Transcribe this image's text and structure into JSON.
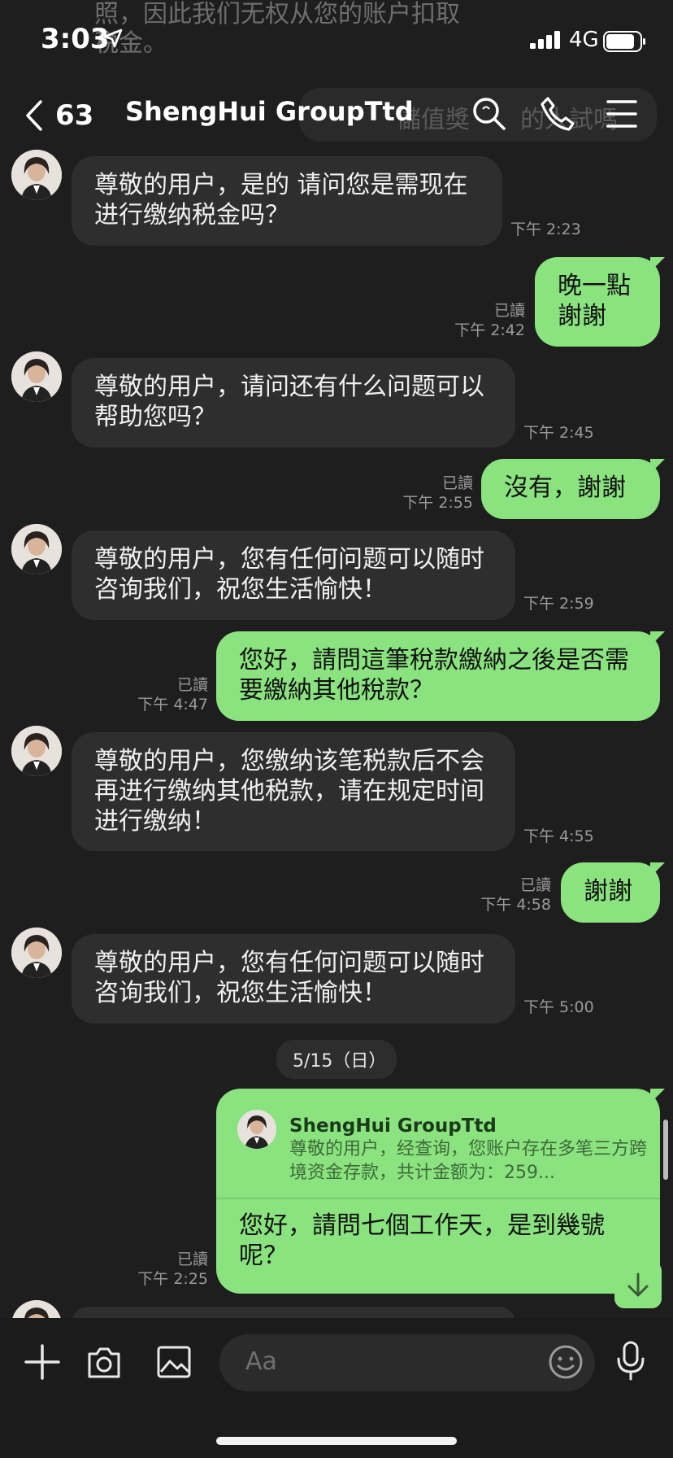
{
  "status_bar": {
    "time": "3:03",
    "network": "4G"
  },
  "ghost": {
    "line1": "照，因此我们无权从您的账户扣取",
    "line2": "税金。",
    "line3": "儲值獎",
    "line3b": "的人試嗎"
  },
  "header": {
    "back_count": "63",
    "title": "ShengHui GroupTtd"
  },
  "messages": [
    {
      "dir": "in",
      "text": "尊敬的用户，是的  请问您是需现在进行缴纳税金吗？",
      "time": "下午 2:23"
    },
    {
      "dir": "out",
      "text": "晚一點謝謝",
      "read": "已讀",
      "time": "下午 2:42"
    },
    {
      "dir": "in",
      "text": "尊敬的用户，请问还有什么问题可以帮助您吗？",
      "time": "下午 2:45"
    },
    {
      "dir": "out",
      "text": "沒有，謝謝",
      "read": "已讀",
      "time": "下午 2:55"
    },
    {
      "dir": "in",
      "text": "尊敬的用户，您有任何问题可以随时咨询我们，祝您生活愉快！",
      "time": "下午 2:59"
    },
    {
      "dir": "out",
      "text": "您好，請問這筆稅款繳納之後是否需要繳納其他稅款？",
      "read": "已讀",
      "time": "下午 4:47"
    },
    {
      "dir": "in",
      "text": "尊敬的用户，您缴纳该笔税款后不会再进行缴纳其他税款，请在规定时间进行缴纳！",
      "time": "下午 4:55"
    },
    {
      "dir": "out",
      "text": "謝謝",
      "read": "已讀",
      "time": "下午 4:58"
    },
    {
      "dir": "in",
      "text": "尊敬的用户，您有任何问题可以随时咨询我们，祝您生活愉快！",
      "time": "下午 5:00"
    }
  ],
  "date_separator": "5/15（日）",
  "reply_message": {
    "quoted_name": "ShengHui GroupTtd",
    "quoted_text": "尊敬的用户，经查询，您账户存在多笔三方跨境资金存款，共计金额为：259...",
    "text": "您好，請問七個工作天，是到幾號呢？",
    "read": "已讀",
    "time": "下午 2:25"
  },
  "input": {
    "placeholder": "Aa"
  },
  "colors": {
    "outgoing_bubble": "#8ae37f",
    "incoming_bubble": "#2e2e2e",
    "background": "#1e1e1e"
  },
  "icons": [
    "location-arrow-icon",
    "signal-icon",
    "battery-icon",
    "back-chevron-icon",
    "search-icon",
    "phone-icon",
    "menu-icon",
    "plus-icon",
    "camera-icon",
    "image-icon",
    "emoji-icon",
    "microphone-icon",
    "arrow-down-icon"
  ]
}
